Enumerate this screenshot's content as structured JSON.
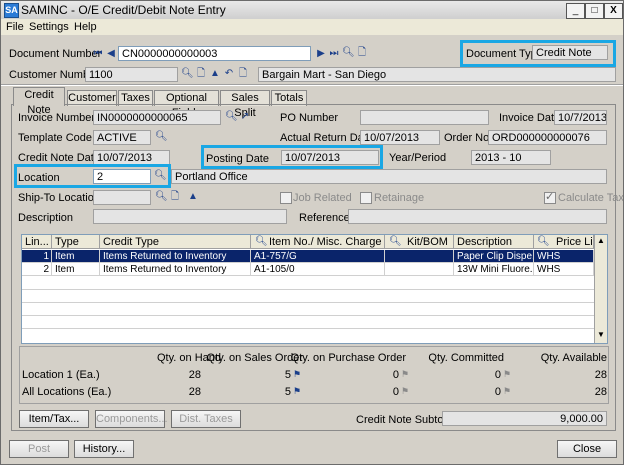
{
  "window": {
    "title": "SAMINC - O/E Credit/Debit Note Entry",
    "app_icon": "SA",
    "controls": {
      "minimize": "_",
      "maximize": "□",
      "close": "X"
    }
  },
  "menu": [
    "File",
    "Settings",
    "Help"
  ],
  "header": {
    "document_number_label": "Document Number",
    "document_number": "CN0000000000003",
    "document_type_label": "Document Type",
    "document_type": "Credit Note",
    "customer_number_label": "Customer Number",
    "customer_number": "1100",
    "customer_name": "Bargain Mart - San Diego"
  },
  "tabs": [
    "Credit Note",
    "Customer",
    "Taxes",
    "Optional Fields",
    "Sales Split",
    "Totals"
  ],
  "form": {
    "invoice_number_label": "Invoice Number",
    "invoice_number": "IN0000000000065",
    "po_number_label": "PO Number",
    "po_number": "",
    "invoice_date_label": "Invoice Date",
    "invoice_date": "10/7/2013",
    "template_code_label": "Template Code",
    "template_code": "ACTIVE",
    "actual_return_date_label": "Actual Return Date",
    "actual_return_date": "10/07/2013",
    "order_no_label": "Order No.",
    "order_no": "ORD000000000076",
    "credit_note_date_label": "Credit Note Date",
    "credit_note_date": "10/07/2013",
    "posting_date_label": "Posting Date",
    "posting_date": "10/07/2013",
    "year_period_label": "Year/Period",
    "year_period": "2013 - 10",
    "location_label": "Location",
    "location": "2",
    "location_desc": "Portland Office",
    "ship_to_label": "Ship-To Location",
    "ship_to": "",
    "job_related_label": "Job Related",
    "retainage_label": "Retainage",
    "calculate_tax_label": "Calculate Tax",
    "description_label": "Description",
    "description": "",
    "reference_label": "Reference",
    "reference": ""
  },
  "grid": {
    "columns": [
      "Lin...",
      "Type",
      "Credit Type",
      "Item No./ Misc. Charge",
      "Kit/BOM",
      "Description",
      "Price List"
    ],
    "rows": [
      {
        "line": "1",
        "type": "Item",
        "credit_type": "Items Returned to Inventory",
        "item": "A1-757/G",
        "kit": "",
        "description": "Paper Clip Dispe...",
        "price_list": "WHS"
      },
      {
        "line": "2",
        "type": "Item",
        "credit_type": "Items Returned to Inventory",
        "item": "A1-105/0",
        "kit": "",
        "description": "13W Mini Fluore...",
        "price_list": "WHS"
      }
    ]
  },
  "stock": {
    "headers": [
      "Qty. on Hand",
      "Qty. on Sales Order",
      "Qty. on Purchase Order",
      "Qty. Committed",
      "Qty. Available"
    ],
    "rows": [
      {
        "label": "Location  1 (Ea.)",
        "values": [
          "28",
          "5",
          "0",
          "0",
          "28"
        ]
      },
      {
        "label": "All Locations (Ea.)",
        "values": [
          "28",
          "5",
          "0",
          "0",
          "28"
        ]
      }
    ]
  },
  "buttons": {
    "item_tax": "Item/Tax...",
    "components": "Components...",
    "dist_taxes": "Dist. Taxes",
    "post": "Post",
    "history": "History...",
    "close": "Close"
  },
  "subtotal_label": "Credit Note Subtotal",
  "subtotal": "9,000.00",
  "colors": {
    "highlight": "#1aa7e4",
    "selected_row": "#0a246a"
  }
}
